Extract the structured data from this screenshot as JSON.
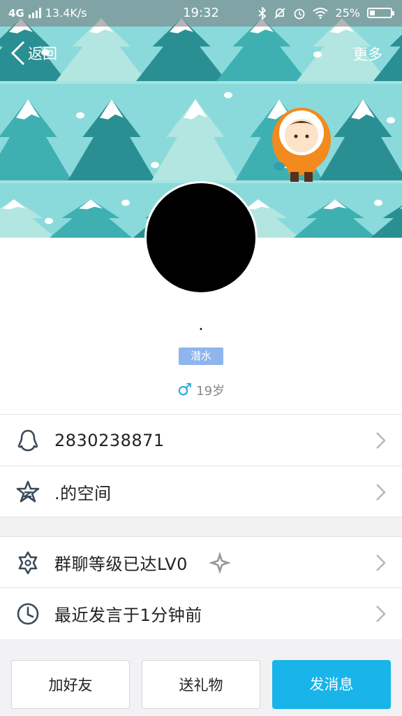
{
  "status_bar": {
    "network": "4G",
    "speed": "13.4K/s",
    "time": "19:32",
    "battery": "25%",
    "battery_level": 0.25
  },
  "nav": {
    "back_label": "返回",
    "more_label": "更多"
  },
  "profile": {
    "nickname": ".",
    "level_badge": "潜水",
    "age": "19岁",
    "gender_symbol": "♂"
  },
  "rows": [
    {
      "text": "2830238871",
      "icon": "penguin-icon"
    },
    {
      "text": ".的空间",
      "icon": "star-icon"
    },
    {
      "text": "群聊等级已达LV0",
      "icon": "hexagram-icon"
    },
    {
      "text": "最近发言于1分钟前",
      "icon": "clock-icon"
    }
  ],
  "buttons": {
    "add_friend": "加好友",
    "send_gift": "送礼物",
    "send_message": "发消息"
  },
  "colors": {
    "banner_bg": "#8adadb",
    "tree_dark": "#2a8f93",
    "tree_mid": "#3fb0b2",
    "tree_light": "#b3e6e0",
    "accent": "#18b4ea",
    "badge": "#8eb5ec"
  }
}
